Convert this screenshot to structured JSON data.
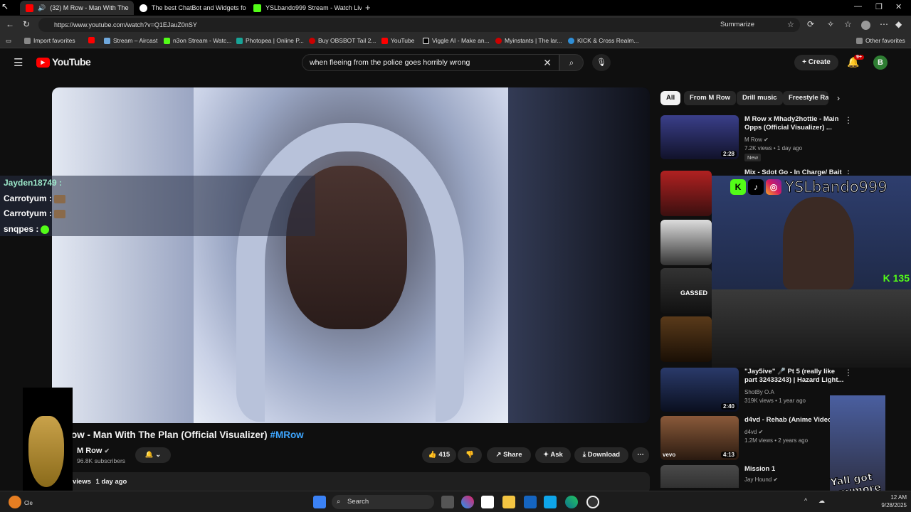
{
  "browser": {
    "tabs": [
      {
        "label": "(32) M Row - Man With The",
        "active": true
      },
      {
        "label": "The best ChatBot and Widgets fo",
        "active": false
      },
      {
        "label": "YSLbando999 Stream - Watch Liv",
        "active": false
      }
    ],
    "url": "https://www.youtube.com/watch?v=Q1EJauZ0nSY",
    "summarize_label": "Summarize",
    "bookmarks": [
      "Import favorites",
      "Stream – Aircast",
      "n3on Stream - Watc...",
      "Photopea | Online P...",
      "Buy OBSBOT Tail 2...",
      "YouTube",
      "Viggle AI - Make an...",
      "Myinstants | The lar...",
      "KICK & Cross Realm..."
    ],
    "other_favorites": "Other favorites"
  },
  "youtube": {
    "logo_text": "YouTube",
    "search_value": "when fleeing from the police goes horribly wrong",
    "create_label": "Create",
    "notif_count": "9+",
    "avatar_letter": "B"
  },
  "chat": [
    {
      "user": "Jayden18749 :",
      "green": true
    },
    {
      "user": "Carrotyum :",
      "green": false
    },
    {
      "user": "Carrotyum :",
      "green": false
    },
    {
      "user": "snqpes :",
      "green": false
    }
  ],
  "video": {
    "title": "ow - Man With The Plan (Official Visualizer)",
    "hashtag": "#MRow",
    "channel": "M Row",
    "subscribers": "96.8K subscribers",
    "likes": "415",
    "share_label": "Share",
    "ask_label": "Ask",
    "download_label": "Download",
    "views_text": "views",
    "age": "1 day ago"
  },
  "chips": [
    "All",
    "From M Row",
    "Drill music",
    "Freestyle Ra"
  ],
  "recommendations": [
    {
      "title": "M Row x Mhady2hottie - Main Opps (Official Visualizer) ...",
      "channel": "M Row",
      "meta": "7.2K views • 1 day ago",
      "duration": "2:28",
      "badge": "New"
    },
    {
      "title": "Mix - Sdot Go - In Charge/ Bait",
      "channel": "",
      "meta": "",
      "duration": "",
      "badge": ""
    },
    {
      "title": "\"Jay5ive\" 🎤 Pt 5 (really like part 32433243) | Hazard Light...",
      "channel": "ShotBy O.A",
      "meta": "319K views • 1 year ago",
      "duration": "2:40",
      "badge": ""
    },
    {
      "title": "d4vd - Rehab (Anime Video)",
      "channel": "d4vd",
      "meta": "1.2M views • 2 years ago",
      "duration": "4:13",
      "badge": ""
    },
    {
      "title": "Mission 1",
      "channel": "Jay Hound",
      "meta": "",
      "duration": "",
      "badge": ""
    }
  ],
  "thumb_labels": {
    "gassed": "GASSED",
    "vevo": "vevo"
  },
  "webcam": {
    "brand_name": "YSLbando999",
    "kick_count": "135"
  },
  "meme_text": "Yall got anymore of them KICKS!!!",
  "taskbar": {
    "search_placeholder": "Search",
    "time": "12 AM",
    "date": "9/28/2025",
    "left_label": "Cle"
  },
  "colors": {
    "accent_red": "#ff0000",
    "link_blue": "#3ea6ff",
    "kick_green": "#53fc18"
  }
}
